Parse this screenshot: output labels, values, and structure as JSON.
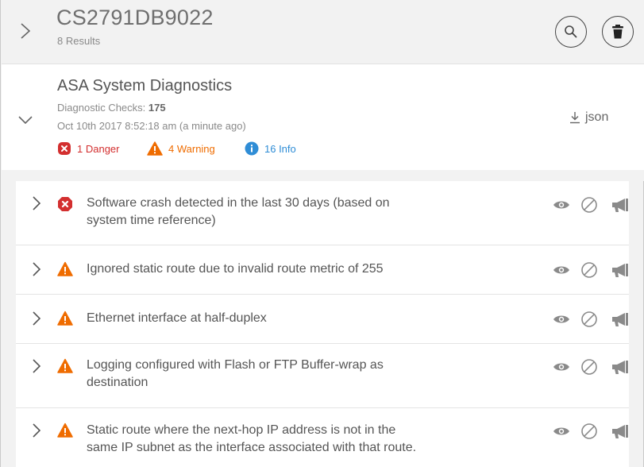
{
  "header": {
    "title": "CS2791DB9022",
    "subtitle": "8 Results",
    "icons": {
      "expand": "chevron-right-icon",
      "search": "search-icon",
      "delete": "trash-icon"
    }
  },
  "diagnostics": {
    "title": "ASA System Diagnostics",
    "checks_label": "Diagnostic Checks: ",
    "checks_count": "175",
    "date": "Oct 10th 2017 8:52:18 am (a minute ago)",
    "danger": "1 Danger",
    "warning": "4 Warning",
    "info": "16 Info",
    "export_label": "json",
    "colors": {
      "danger": "#d32f2f",
      "warning": "#ef6c00",
      "info": "#2f8dd6"
    }
  },
  "issues": [
    {
      "severity": "danger",
      "line1": "Software crash detected in the last 30 days (based on",
      "line2": "system time reference)"
    },
    {
      "severity": "warning",
      "line1": "Ignored static route due to invalid route metric of 255",
      "line2": ""
    },
    {
      "severity": "warning",
      "line1": "Ethernet interface at half-duplex",
      "line2": ""
    },
    {
      "severity": "warning",
      "line1": "Logging configured with Flash or FTP Buffer-wrap as",
      "line2": "destination"
    },
    {
      "severity": "warning",
      "line1": "Static route where the next-hop IP address is not in the",
      "line2": "same IP subnet as the interface associated with that route."
    }
  ],
  "row_actions": [
    "eye-icon",
    "ignore-icon",
    "megaphone-icon"
  ]
}
